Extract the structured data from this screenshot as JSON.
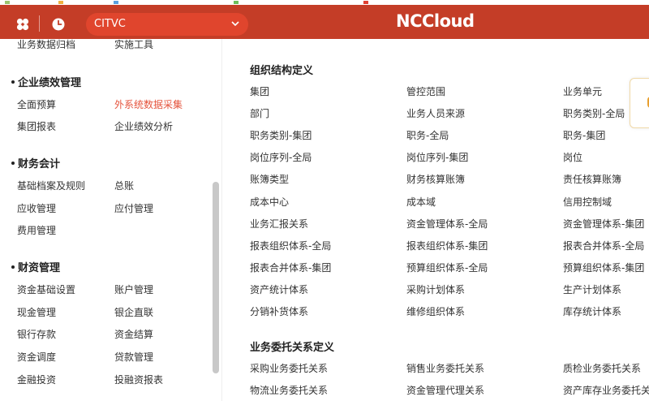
{
  "header": {
    "org_value": "CITVC",
    "brand": "NCCloud",
    "bar_color": "#c43d27"
  },
  "sidebar": {
    "groups": [
      {
        "label": "",
        "items": [
          {
            "label": "业务数据归档",
            "active": false
          },
          {
            "label": "实施工具",
            "active": false
          }
        ]
      },
      {
        "label": "企业绩效管理",
        "items": [
          {
            "label": "全面预算",
            "active": false
          },
          {
            "label": "外系统数据采集",
            "active": true
          },
          {
            "label": "集团报表",
            "active": false
          },
          {
            "label": "企业绩效分析",
            "active": false
          }
        ]
      },
      {
        "label": "财务会计",
        "items": [
          {
            "label": "基础档案及规则",
            "active": false
          },
          {
            "label": "总账",
            "active": false
          },
          {
            "label": "应收管理",
            "active": false
          },
          {
            "label": "应付管理",
            "active": false
          },
          {
            "label": "费用管理",
            "active": false
          }
        ]
      },
      {
        "label": "财资管理",
        "items": [
          {
            "label": "资金基础设置",
            "active": false
          },
          {
            "label": "账户管理",
            "active": false
          },
          {
            "label": "现金管理",
            "active": false
          },
          {
            "label": "银企直联",
            "active": false
          },
          {
            "label": "银行存款",
            "active": false
          },
          {
            "label": "资金结算",
            "active": false
          },
          {
            "label": "资金调度",
            "active": false
          },
          {
            "label": "贷款管理",
            "active": false
          },
          {
            "label": "金融投资",
            "active": false
          },
          {
            "label": "投融资报表",
            "active": false
          }
        ]
      }
    ]
  },
  "main": {
    "sections": [
      {
        "title": "组织结构定义",
        "items": [
          "集团",
          "管控范围",
          "业务单元",
          "部门",
          "业务人员来源",
          "职务类别-全局",
          "职务类别-集团",
          "职务-全局",
          "职务-集团",
          "岗位序列-全局",
          "岗位序列-集团",
          "岗位",
          "账簿类型",
          "财务核算账簿",
          "责任核算账簿",
          "成本中心",
          "成本域",
          "信用控制域",
          "业务汇报关系",
          "资金管理体系-全局",
          "资金管理体系-集团",
          "报表组织体系-全局",
          "报表组织体系-集团",
          "报表合并体系-全局",
          "报表合并体系-集团",
          "预算组织体系-全局",
          "预算组织体系-集团",
          "资产统计体系",
          "采购计划体系",
          "生产计划体系",
          "分销补货体系",
          "维修组织体系",
          "库存统计体系"
        ]
      },
      {
        "title": "业务委托关系定义",
        "items": [
          "采购业务委托关系",
          "销售业务委托关系",
          "质检业务委托关系",
          "物流业务委托关系",
          "资金管理代理关系",
          "资产库存业务委托关系"
        ]
      }
    ]
  }
}
